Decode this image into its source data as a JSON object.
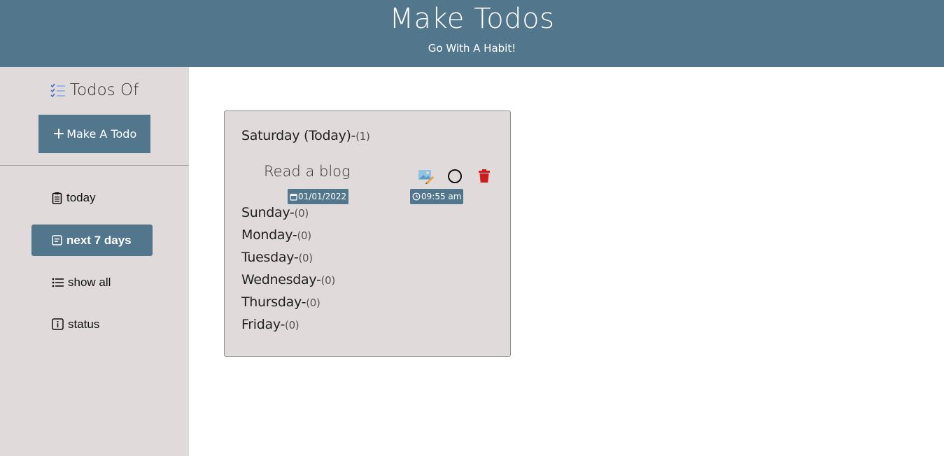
{
  "header": {
    "title": "Make Todos",
    "subtitle": "Go With A Habit!"
  },
  "sidebar": {
    "heading": "Todos Of",
    "make_button": "Make A Todo",
    "items": [
      {
        "label": "today",
        "icon": "clipboard-icon",
        "active": false
      },
      {
        "label": "next 7 days",
        "icon": "calendar-week-icon",
        "active": true
      },
      {
        "label": "show all",
        "icon": "list-icon",
        "active": false
      },
      {
        "label": "status",
        "icon": "info-icon",
        "active": false
      }
    ]
  },
  "main": {
    "days": [
      {
        "name": "Saturday (Today)",
        "sep": "-",
        "count": "(1)"
      },
      {
        "name": "Sunday",
        "sep": "-",
        "count": "(0)"
      },
      {
        "name": "Monday",
        "sep": "-",
        "count": "(0)"
      },
      {
        "name": "Tuesday",
        "sep": "-",
        "count": "(0)"
      },
      {
        "name": "Wednesday",
        "sep": "-",
        "count": "(0)"
      },
      {
        "name": "Thursday",
        "sep": "-",
        "count": "(0)"
      },
      {
        "name": "Friday",
        "sep": "-",
        "count": "(0)"
      }
    ],
    "todo": {
      "title": "Read a blog",
      "date": "01/01/2022",
      "time": "09:55 am",
      "actions": [
        "edit-icon",
        "complete-circle-icon",
        "delete-icon"
      ]
    }
  },
  "colors": {
    "header": "#52768c",
    "sidebar": "#e0dada",
    "accent": "#52768c",
    "delete": "#d11a1a"
  }
}
